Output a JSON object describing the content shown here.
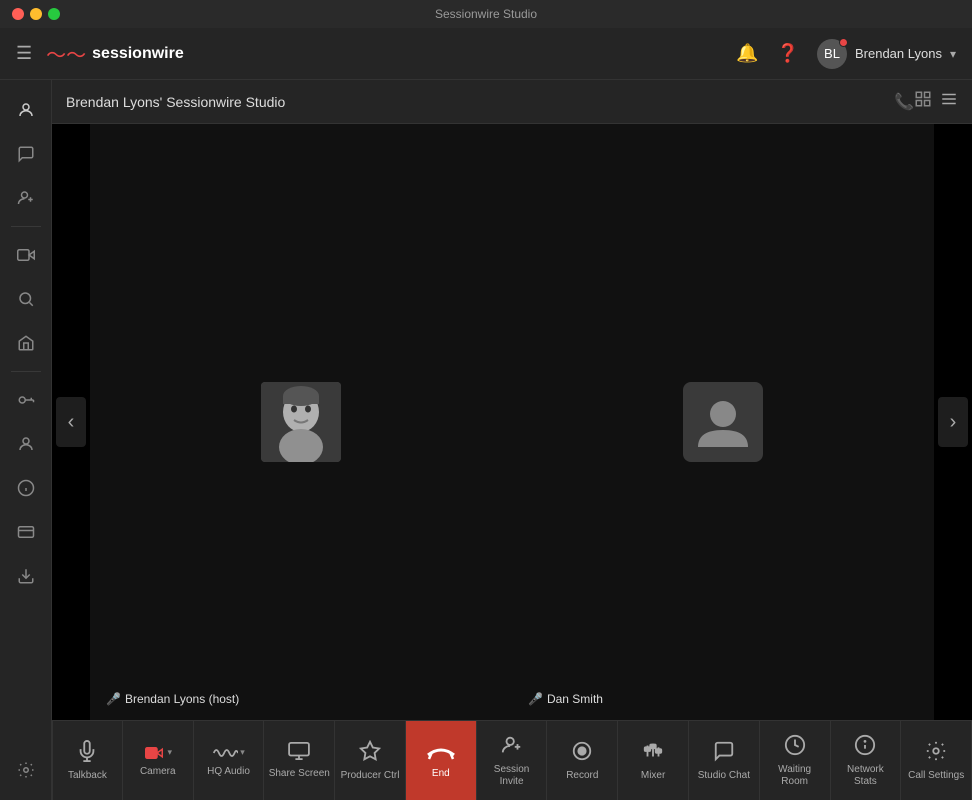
{
  "titlebar": {
    "title": "Sessionwire Studio"
  },
  "header": {
    "logo_text": "sessionwire",
    "user_name": "Brendan Lyons",
    "chevron": "▾"
  },
  "studio": {
    "title": "Brendan Lyons' Sessionwire Studio",
    "view_grid_icon": "⊞",
    "view_list_icon": "≡"
  },
  "sidebar": {
    "items": [
      {
        "id": "profile",
        "icon": "👤"
      },
      {
        "id": "chat",
        "icon": "💬"
      },
      {
        "id": "add-user",
        "icon": "👤+"
      },
      {
        "id": "video",
        "icon": "🎥"
      },
      {
        "id": "search",
        "icon": "🔍"
      },
      {
        "id": "home",
        "icon": "🏠"
      },
      {
        "id": "key",
        "icon": "🔑"
      },
      {
        "id": "person",
        "icon": "👤"
      },
      {
        "id": "info",
        "icon": "ℹ"
      },
      {
        "id": "card",
        "icon": "🪪"
      },
      {
        "id": "download",
        "icon": "⬇"
      },
      {
        "id": "settings",
        "icon": "⚙"
      }
    ]
  },
  "participants": [
    {
      "id": "brendan",
      "name": "Brendan Lyons (host)",
      "has_photo": true,
      "mic_active": true
    },
    {
      "id": "dan",
      "name": "Dan Smith",
      "has_photo": false,
      "mic_active": true
    }
  ],
  "toolbar": {
    "items": [
      {
        "id": "talkback",
        "label": "Talkback",
        "icon": "🎙"
      },
      {
        "id": "camera",
        "label": "Camera",
        "icon": "📷",
        "has_chevron": true,
        "is_active_red": true
      },
      {
        "id": "hq-audio",
        "label": "HQ Audio",
        "icon": "〜",
        "has_chevron": true
      },
      {
        "id": "share-screen",
        "label": "Share Screen",
        "icon": "🖥"
      },
      {
        "id": "producer-ctrl",
        "label": "Producer Ctrl",
        "icon": "📡"
      },
      {
        "id": "end",
        "label": "End",
        "icon": "📞"
      },
      {
        "id": "session-invite",
        "label": "Session Invite",
        "icon": "👤+"
      },
      {
        "id": "record",
        "label": "Record",
        "icon": "⏺"
      },
      {
        "id": "mixer",
        "label": "Mixer",
        "icon": "🎛"
      },
      {
        "id": "studio-chat",
        "label": "Studio Chat",
        "icon": "💬"
      },
      {
        "id": "waiting-room",
        "label": "Waiting Room",
        "icon": "🕐"
      },
      {
        "id": "network-stats",
        "label": "Network Stats",
        "icon": "ℹ"
      },
      {
        "id": "call-settings",
        "label": "Call Settings",
        "icon": "⚙"
      }
    ]
  }
}
